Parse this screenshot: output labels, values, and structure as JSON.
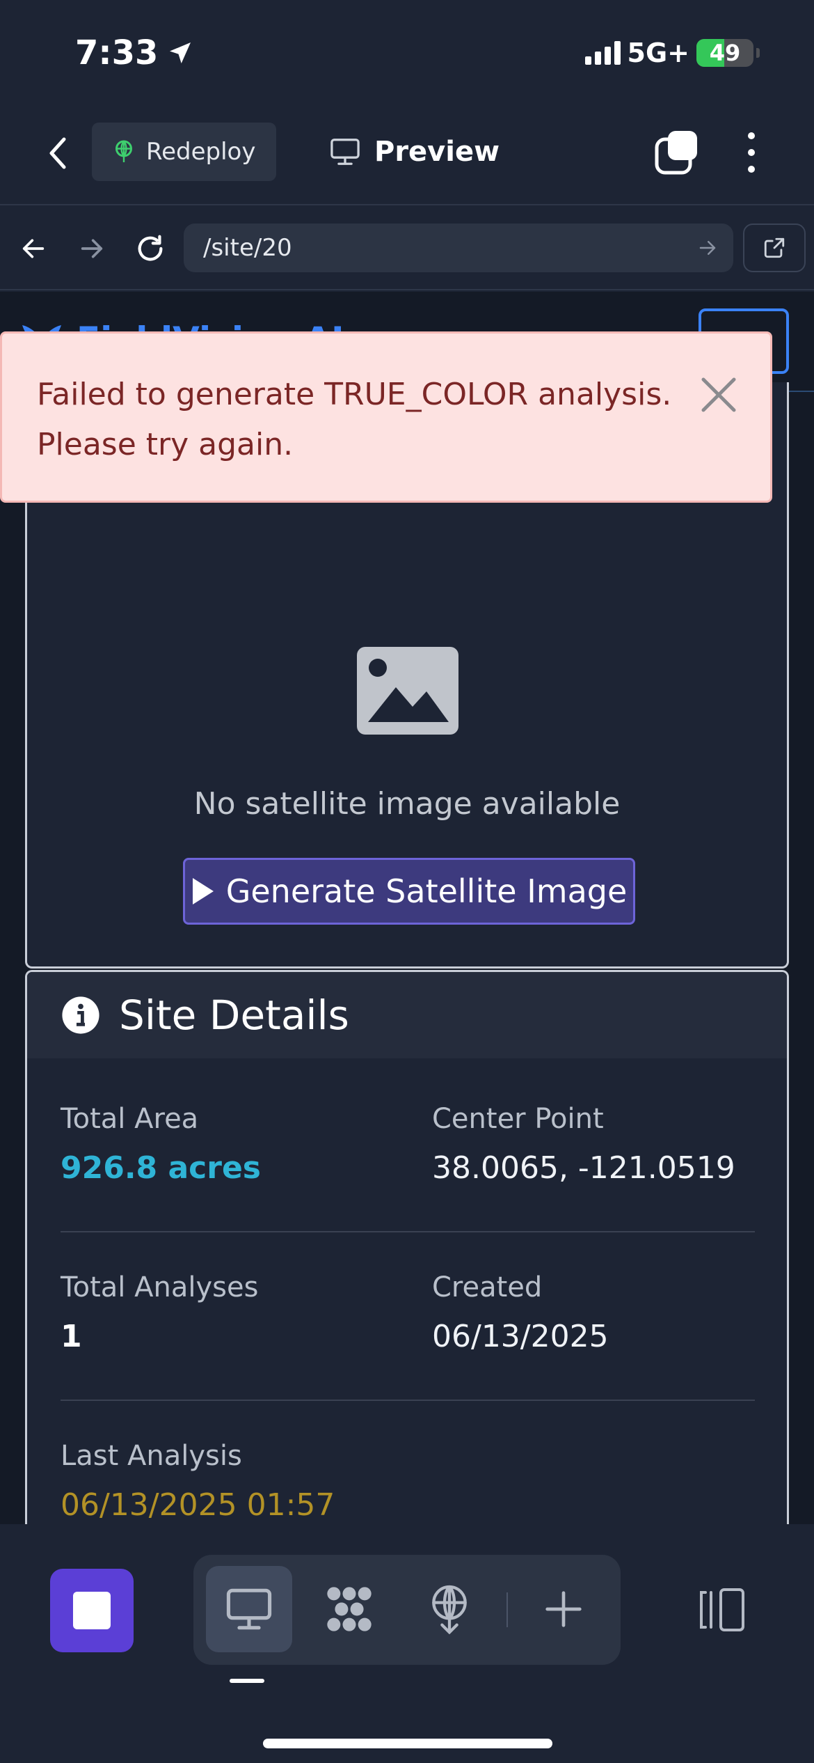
{
  "status_bar": {
    "time": "7:33",
    "network": "5G+",
    "battery": "49"
  },
  "toolbar": {
    "redeploy_label": "Redeploy",
    "preview_label": "Preview"
  },
  "browser": {
    "url": "/site/20"
  },
  "site": {
    "brand": "FieldVision AI"
  },
  "satellite": {
    "empty_text": "No satellite image available",
    "generate_label": "Generate Satellite Image"
  },
  "details": {
    "title": "Site Details",
    "total_area": {
      "label": "Total Area",
      "value": "926.8 acres"
    },
    "center_point": {
      "label": "Center Point",
      "value": "38.0065, -121.0519"
    },
    "total_analyses": {
      "label": "Total Analyses",
      "value": "1"
    },
    "created": {
      "label": "Created",
      "value": "06/13/2025"
    },
    "last_analysis": {
      "label": "Last Analysis",
      "value": "06/13/2025 01:57"
    }
  },
  "toast": {
    "message": "Failed to generate TRUE_COLOR analysis. Please try again."
  },
  "colors": {
    "accent": "#3b82f6",
    "primary_button": "#3d3a7e",
    "stop_button": "#5b3fd6",
    "area_value": "#2fb4d6",
    "last_analysis_value": "#b39226",
    "error_bg": "#fde2e1",
    "error_text": "#7b2626"
  },
  "icons": [
    "location-arrow-icon",
    "signal-icon",
    "battery-icon",
    "back-chevron-icon",
    "deploy-icon",
    "monitor-icon",
    "tabs-icon",
    "more-vertical-icon",
    "arrow-left-icon",
    "arrow-right-icon",
    "reload-icon",
    "external-link-icon",
    "logo-icon",
    "hamburger-icon",
    "image-placeholder-icon",
    "play-icon",
    "info-icon",
    "close-icon",
    "stop-icon",
    "apps-icon",
    "add-icon",
    "panel-icon"
  ]
}
